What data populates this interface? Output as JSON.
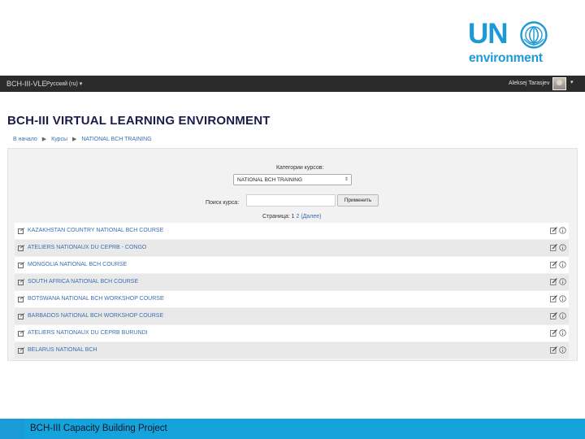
{
  "logo": {
    "un": "UN",
    "environment": "environment",
    "color": "#1b9ad6"
  },
  "navbar": {
    "brand": "BCH-III-VLE",
    "language": "Русский (ru)",
    "language_caret": "▾",
    "user_name": "Aleksej Tarasjev",
    "user_caret": "▾"
  },
  "site_title": "BCH-III VIRTUAL LEARNING ENVIRONMENT",
  "breadcrumb": {
    "home": "В начало",
    "courses": "Курсы",
    "current": "NATIONAL BCH TRAINING",
    "separator": "▶"
  },
  "category": {
    "label": "Категории курсов:",
    "selected": "NATIONAL BCH TRAINING",
    "arrow": "⇕"
  },
  "search": {
    "label": "Поиск курса:",
    "value": "",
    "button": "Применить"
  },
  "pager": {
    "prefix": "Страница: ",
    "page1": "1",
    "page2": "2",
    "next": "(Далее)"
  },
  "courses": [
    {
      "name": "KAZAKHSTAN COUNTRY NATIONAL BCH COURSE"
    },
    {
      "name": "ATELIERS NATIONAUX DU CEPRB - CONGO"
    },
    {
      "name": "MONGOLIA NATIONAL BCH COURSE"
    },
    {
      "name": "SOUTH AFRICA NATIONAL BCH COURSE"
    },
    {
      "name": "BOTSWANA NATIONAL BCH WORKSHOP COURSE"
    },
    {
      "name": "BARBADOS NATIONAL BCH WORKSHOP COURSE"
    },
    {
      "name": "ATELIERS NATIONAUX DU CEPRB BURUNDI"
    },
    {
      "name": "BELARUS NATIONAL BCH"
    }
  ],
  "icons": {
    "course": "course-icon",
    "edit": "edit-icon",
    "info": "info-icon"
  },
  "footer": {
    "text": "BCH-III Capacity Building Project",
    "color": "#1a9bd7"
  }
}
